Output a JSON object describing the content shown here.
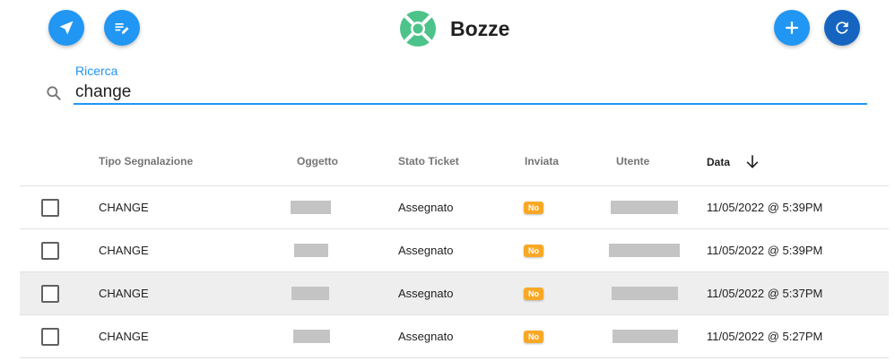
{
  "header": {
    "title": "Bozze",
    "left_buttons": [
      {
        "name": "send",
        "icon": "send-icon"
      },
      {
        "name": "edit-list",
        "icon": "edit-note-icon"
      }
    ],
    "right_buttons": [
      {
        "name": "add",
        "icon": "plus-icon"
      },
      {
        "name": "refresh",
        "icon": "refresh-icon"
      }
    ],
    "logo_icon": "lifebuoy-icon"
  },
  "search": {
    "label": "Ricerca",
    "value": "change",
    "icon": "search-icon"
  },
  "table": {
    "columns": {
      "tipo": "Tipo Segnalazione",
      "oggetto": "Oggetto",
      "stato": "Stato Ticket",
      "inviata": "Inviata",
      "utente": "Utente",
      "data": "Data"
    },
    "sort": {
      "column": "data",
      "direction": "descending",
      "icon": "arrow-down-icon"
    },
    "rows": [
      {
        "tipo": "CHANGE",
        "oggetto": "",
        "stato": "Assegnato",
        "inviata": "No",
        "utente": "",
        "data": "11/05/2022 @ 5:39PM",
        "highlighted": false
      },
      {
        "tipo": "CHANGE",
        "oggetto": "",
        "stato": "Assegnato",
        "inviata": "No",
        "utente": "",
        "data": "11/05/2022 @ 5:39PM",
        "highlighted": false
      },
      {
        "tipo": "CHANGE",
        "oggetto": "",
        "stato": "Assegnato",
        "inviata": "No",
        "utente": "",
        "data": "11/05/2022 @ 5:37PM",
        "highlighted": true
      },
      {
        "tipo": "CHANGE",
        "oggetto": "",
        "stato": "Assegnato",
        "inviata": "No",
        "utente": "",
        "data": "11/05/2022 @ 5:27PM",
        "highlighted": false
      }
    ]
  },
  "colors": {
    "primary": "#2196f3",
    "primary_dark": "#1565c0",
    "logo": "#4cc38a",
    "badge": "#f9a825",
    "redacted": "#c4c4c4",
    "row_highlight": "#eeeeee"
  }
}
